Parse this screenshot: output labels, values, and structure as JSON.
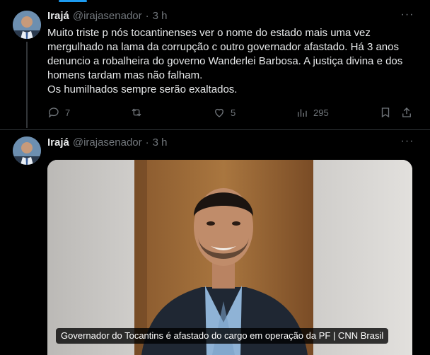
{
  "colors": {
    "background": "#000000",
    "text": "#e7e9ea",
    "muted": "#71767b",
    "accent": "#1d9bf0"
  },
  "tweets": [
    {
      "author": {
        "name": "Irajá",
        "handle": "@irajasenador",
        "separator": "·",
        "time": "3 h"
      },
      "text": "Muito triste p nós tocantinenses ver o nome do estado mais uma vez\nmergulhado na lama da corrupção c outro governador afastado. Há 3 anos\ndenuncio a robalheira do governo Wanderlei Barbosa. A justiça divina e dos\nhomens tardam mas não falham.\nOs humilhados sempre serão exaltados.",
      "actions": {
        "replies": "7",
        "reposts": "",
        "likes": "5",
        "views": "295"
      },
      "icons": [
        "reply-icon",
        "repost-icon",
        "like-icon",
        "views-icon",
        "bookmark-icon",
        "share-icon"
      ]
    },
    {
      "author": {
        "name": "Irajá",
        "handle": "@irajasenador",
        "separator": "·",
        "time": "3 h"
      },
      "media_caption": "Governador do Tocantins é afastado do cargo em operação da PF | CNN Brasil"
    }
  ],
  "more_icon": "more-options-icon"
}
